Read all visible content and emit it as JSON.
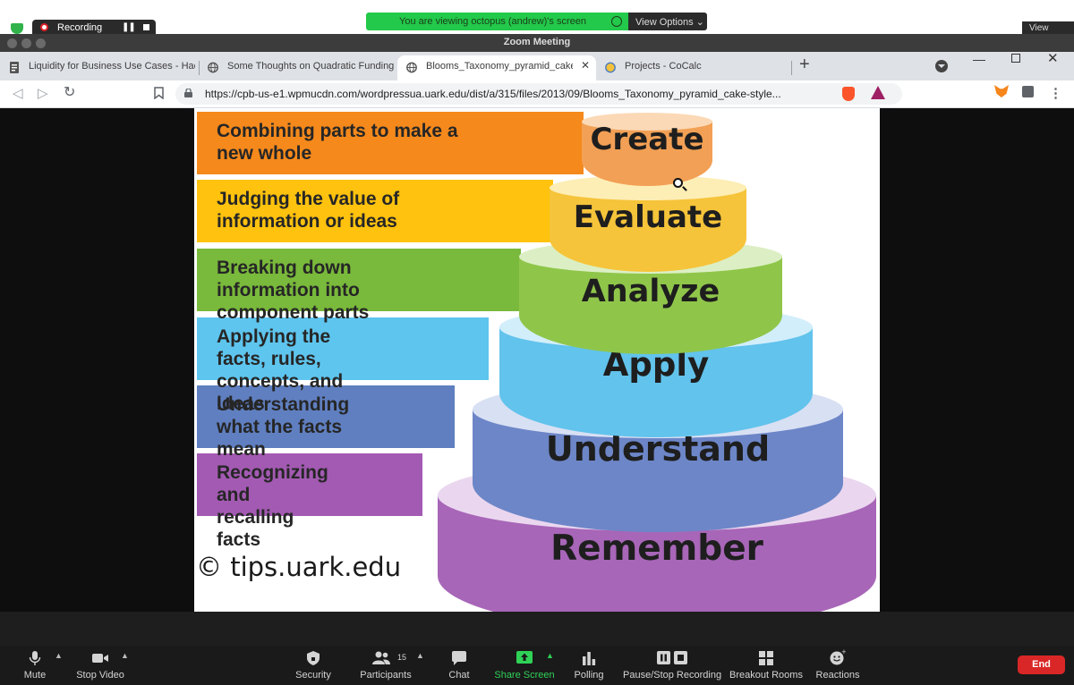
{
  "overlay": {
    "recording_label": "Recording",
    "share_banner": "You are viewing octopus (andrew)'s screen",
    "view_options": "View Options ⌄",
    "view_corner": "View"
  },
  "zoom": {
    "window_title": "Zoom Meeting"
  },
  "browser": {
    "tabs": [
      {
        "title": "Liquidity for Business Use Cases - Hac",
        "icon": "page-icon"
      },
      {
        "title": "Some Thoughts on Quadratic Funding",
        "icon": "globe-icon"
      },
      {
        "title": "Blooms_Taxonomy_pyramid_cake",
        "icon": "globe-icon",
        "active": true
      },
      {
        "title": "Projects - CoCalc",
        "icon": "cocalc-icon"
      }
    ],
    "url": "https://cpb-us-e1.wpmucdn.com/wordpressua.uark.edu/dist/a/315/files/2013/09/Blooms_Taxonomy_pyramid_cake-style..."
  },
  "slide": {
    "levels": [
      {
        "name": "Create",
        "description": "Combining parts to make a new whole",
        "band_color": "#f5891c",
        "tier_color": "#f2a055",
        "tier_top": "#fbd9b6"
      },
      {
        "name": "Evaluate",
        "description": "Judging the value of information or ideas",
        "band_color": "#ffc20e",
        "tier_color": "#f6c43a",
        "tier_top": "#fdeeb5"
      },
      {
        "name": "Analyze",
        "description": "Breaking down information into component parts",
        "band_color": "#79b93b",
        "tier_color": "#8fc64a",
        "tier_top": "#dcefc4"
      },
      {
        "name": "Apply",
        "description": "Applying the facts, rules, concepts, and ideas",
        "band_color": "#5ec5ee",
        "tier_color": "#62c3ec",
        "tier_top": "#d2eefb"
      },
      {
        "name": "Understand",
        "description": "Understanding what the facts mean",
        "band_color": "#5f7fc0",
        "tier_color": "#6d86c8",
        "tier_top": "#d8e0f3"
      },
      {
        "name": "Remember",
        "description": "Recognizing and recalling facts",
        "band_color": "#a35ab2",
        "tier_color": "#a866b8",
        "tier_top": "#ead7ef"
      }
    ],
    "credit": "© tips.uark.edu"
  },
  "meeting_toolbar": {
    "mute": "Mute",
    "stop_video": "Stop Video",
    "security": "Security",
    "participants": "Participants",
    "participant_count": "15",
    "chat": "Chat",
    "share_screen": "Share Screen",
    "polling": "Polling",
    "recording": "Pause/Stop Recording",
    "breakout": "Breakout Rooms",
    "reactions": "Reactions",
    "end": "End"
  },
  "colors": {
    "share_green": "#23c94a",
    "end_red": "#d92626"
  }
}
